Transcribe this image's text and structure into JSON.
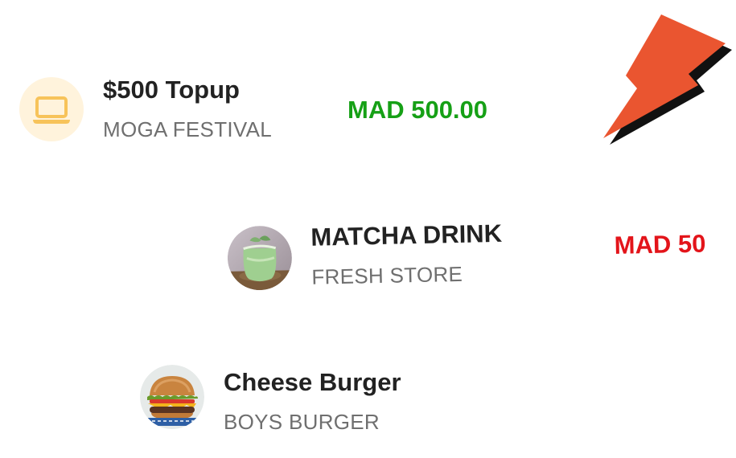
{
  "transactions": [
    {
      "title": "$500 Topup",
      "merchant": "MOGA FESTIVAL",
      "amount": "MAD 500.00",
      "amount_color": "#16a016",
      "icon": "laptop-icon"
    },
    {
      "title": "MATCHA DRINK",
      "merchant": "FRESH STORE",
      "amount": "MAD 50",
      "amount_color": "#e3141a",
      "icon": "matcha-drink-photo"
    },
    {
      "title": "Cheese Burger",
      "merchant": "BOYS BURGER",
      "icon": "cheese-burger-photo"
    }
  ],
  "brand": {
    "logo": "lightning-bolt-logo",
    "color": "#ea5530"
  }
}
